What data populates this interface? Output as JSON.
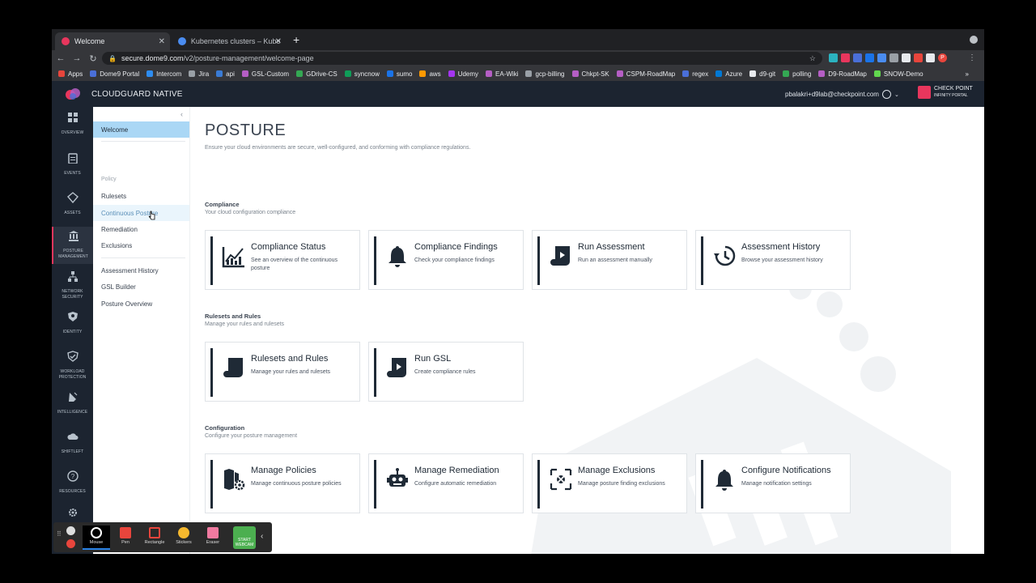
{
  "browser": {
    "tabs": [
      {
        "label": "Welcome",
        "active": true
      },
      {
        "label": "Kubernetes clusters – Kuberne",
        "active": false
      }
    ],
    "url_host": "secure.dome9.com",
    "url_path": "/v2/posture-management/welcome-page",
    "bookmarks": [
      {
        "label": "Apps",
        "color": "#e8453c"
      },
      {
        "label": "Dome9 Portal",
        "color": "#4a6fd8"
      },
      {
        "label": "Intercom",
        "color": "#2d8cf0"
      },
      {
        "label": "Jira",
        "color": "#9aa0a6"
      },
      {
        "label": "api",
        "color": "#3a7bd5"
      },
      {
        "label": "GSL-Custom",
        "color": "#b55ec4"
      },
      {
        "label": "GDrive-CS",
        "color": "#34a853"
      },
      {
        "label": "syncnow",
        "color": "#0f9d58"
      },
      {
        "label": "sumo",
        "color": "#1a73e8"
      },
      {
        "label": "aws",
        "color": "#ff9900"
      },
      {
        "label": "Udemy",
        "color": "#a435f0"
      },
      {
        "label": "EA-Wiki",
        "color": "#b55ec4"
      },
      {
        "label": "gcp-billing",
        "color": "#9aa0a6"
      },
      {
        "label": "Chkpt-SK",
        "color": "#b55ec4"
      },
      {
        "label": "CSPM-RoadMap",
        "color": "#b55ec4"
      },
      {
        "label": "regex",
        "color": "#4a6fd8"
      },
      {
        "label": "Azure",
        "color": "#0078d4"
      },
      {
        "label": "d9-git",
        "color": "#e8eaed"
      },
      {
        "label": "polling",
        "color": "#34a853"
      },
      {
        "label": "D9-RoadMap",
        "color": "#b55ec4"
      },
      {
        "label": "SNOW-Demo",
        "color": "#62d84e"
      }
    ],
    "bookmarks_overflow": "»"
  },
  "header": {
    "app_title": "CLOUDGUARD NATIVE",
    "user_email": "pbalakri+d9lab@checkpoint.com",
    "brand_line1": "CHECK POINT",
    "brand_line2": "INFINITY PORTAL"
  },
  "rail": [
    {
      "label": "OVERVIEW",
      "icon": "grid-icon"
    },
    {
      "label": "EVENTS",
      "icon": "clipboard-icon"
    },
    {
      "label": "ASSETS",
      "icon": "diamond-icon"
    },
    {
      "label": "POSTURE MANAGEMENT",
      "icon": "bank-icon",
      "active": true
    },
    {
      "label": "NETWORK SECURITY",
      "icon": "network-icon"
    },
    {
      "label": "IDENTITY",
      "icon": "shield-user-icon"
    },
    {
      "label": "WORKLOAD PROTECTION",
      "icon": "shield-check-icon"
    },
    {
      "label": "INTELLIGENCE",
      "icon": "satellite-icon"
    },
    {
      "label": "SHIFTLEFT",
      "icon": "cloud-icon"
    },
    {
      "label": "RESOURCES",
      "icon": "help-icon"
    },
    {
      "label": "",
      "icon": "gear-icon"
    }
  ],
  "subnav": {
    "welcome": "Welcome",
    "section_policy": "Policy",
    "rulesets": "Rulesets",
    "continuous_posture": "Continuous Posture",
    "remediation": "Remediation",
    "exclusions": "Exclusions",
    "assessment_history": "Assessment History",
    "gsl_builder": "GSL Builder",
    "posture_overview": "Posture Overview"
  },
  "main": {
    "title": "POSTURE",
    "subtitle": "Ensure your cloud environments are secure, well-configured, and conforming with compliance regulations.",
    "sections": [
      {
        "title": "Compliance",
        "subtitle": "Your cloud configuration compliance",
        "cards": [
          {
            "title": "Compliance Status",
            "desc": "See an overview of the continuous posture",
            "icon": "chart-icon"
          },
          {
            "title": "Compliance Findings",
            "desc": "Check your compliance findings",
            "icon": "bell-icon"
          },
          {
            "title": "Run Assessment",
            "desc": "Run an assessment manually",
            "icon": "scroll-play-icon"
          },
          {
            "title": "Assessment History",
            "desc": "Browse your assessment history",
            "icon": "history-icon"
          }
        ]
      },
      {
        "title": "Rulesets and Rules",
        "subtitle": "Manage your rules and rulesets",
        "cards": [
          {
            "title": "Rulesets and Rules",
            "desc": "Manage your rules and rulesets",
            "icon": "scroll-icon"
          },
          {
            "title": "Run GSL",
            "desc": "Create compliance rules",
            "icon": "scroll-play-icon"
          }
        ]
      },
      {
        "title": "Configuration",
        "subtitle": "Configure your posture management",
        "cards": [
          {
            "title": "Manage Policies",
            "desc": "Manage continuous posture policies",
            "icon": "policy-gear-icon"
          },
          {
            "title": "Manage Remediation",
            "desc": "Configure automatic remediation",
            "icon": "robot-icon"
          },
          {
            "title": "Manage Exclusions",
            "desc": "Manage posture finding exclusions",
            "icon": "exclusion-icon"
          },
          {
            "title": "Configure Notifications",
            "desc": "Manage notification settings",
            "icon": "bell-icon"
          }
        ]
      }
    ]
  },
  "recorder": {
    "tools": [
      "Mouse",
      "Pen",
      "Rectangle",
      "Stickers",
      "Eraser"
    ],
    "webcam_label": "START WEBCAM"
  }
}
